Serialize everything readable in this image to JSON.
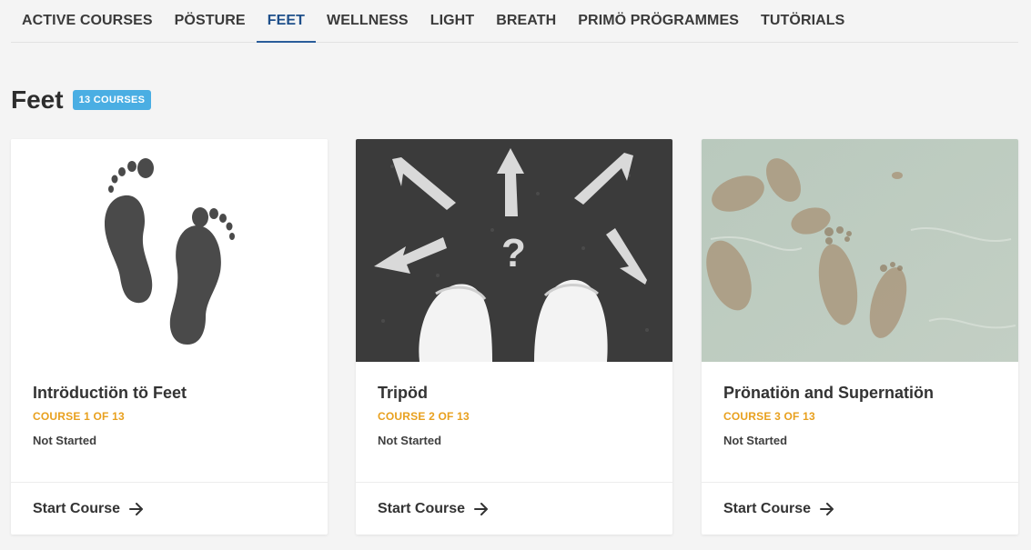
{
  "nav": {
    "tabs": [
      {
        "label": "ACTIVE COURSES",
        "active": false
      },
      {
        "label": "PÖSTURE",
        "active": false
      },
      {
        "label": "FEET",
        "active": true
      },
      {
        "label": "WELLNESS",
        "active": false
      },
      {
        "label": "LIGHT",
        "active": false
      },
      {
        "label": "BREATH",
        "active": false
      },
      {
        "label": "PRIMÖ PRÖGRAMMES",
        "active": false
      },
      {
        "label": "TUTÖRIALS",
        "active": false
      }
    ]
  },
  "section": {
    "title": "Feet",
    "badge": "13 COURSES"
  },
  "courses": [
    {
      "title": "Intröductiön tö Feet",
      "meta": "COURSE 1 OF 13",
      "status": "Not Started",
      "action": "Start Course",
      "image": "footprints-illustration"
    },
    {
      "title": "Tripöd",
      "meta": "COURSE 2 OF 13",
      "status": "Not Started",
      "action": "Start Course",
      "image": "arrows-and-white-shoes-photo"
    },
    {
      "title": "Prönatiön and Supernatiön",
      "meta": "COURSE 3 OF 13",
      "status": "Not Started",
      "action": "Start Course",
      "image": "footprints-in-sand-photo"
    }
  ],
  "colors": {
    "accent": "#2a5d9a",
    "badge": "#4aaee3",
    "meta": "#e8a01e"
  }
}
